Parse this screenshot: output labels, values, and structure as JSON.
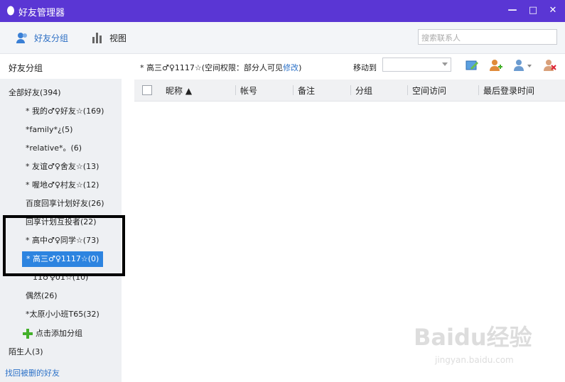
{
  "window": {
    "title": "好友管理器",
    "controls": {
      "minimize": "—",
      "maximize": "□",
      "close": "✕"
    },
    "accent": "#5a36d4"
  },
  "toolbar": {
    "groups_label": "好友分组",
    "view_label": "视图",
    "search_placeholder": "搜索联系人"
  },
  "sidebar": {
    "header": "好友分组",
    "all_friends": "全部好友(394)",
    "groups": [
      "* 我的♂♀好友☆(169)",
      "*family*¿(5)",
      "*relative*。(6)",
      "* 友谊♂♀舍友☆(13)",
      "* 喔地♂♀村友☆(12)",
      "百度回享计划好友(26)",
      "回享计划互投者(22)",
      "* 高中♂♀同学☆(73)",
      "* 高三♂♀1117☆(0)",
      "11♂♀01☆(10)",
      "偶然(26)",
      "*太原小小班T65(32)"
    ],
    "selected_index": 8,
    "add_group": "点击添加分组",
    "strangers": "陌生人(3)",
    "recover_link": "找回被删的好友",
    "selected_color": "#2d84e0"
  },
  "main": {
    "group_info_prefix": "* 高三♂♀1117☆(空间权限：部分人可见",
    "group_info_link": "修改",
    "group_info_suffix": ")",
    "move_to_label": "移动到",
    "columns": [
      "昵称 ▲",
      "帐号",
      "备注",
      "分组",
      "空间访问",
      "最后登录时间"
    ]
  },
  "watermark": {
    "brand": "Baidu经验",
    "url": "jingyan.baidu.com"
  }
}
